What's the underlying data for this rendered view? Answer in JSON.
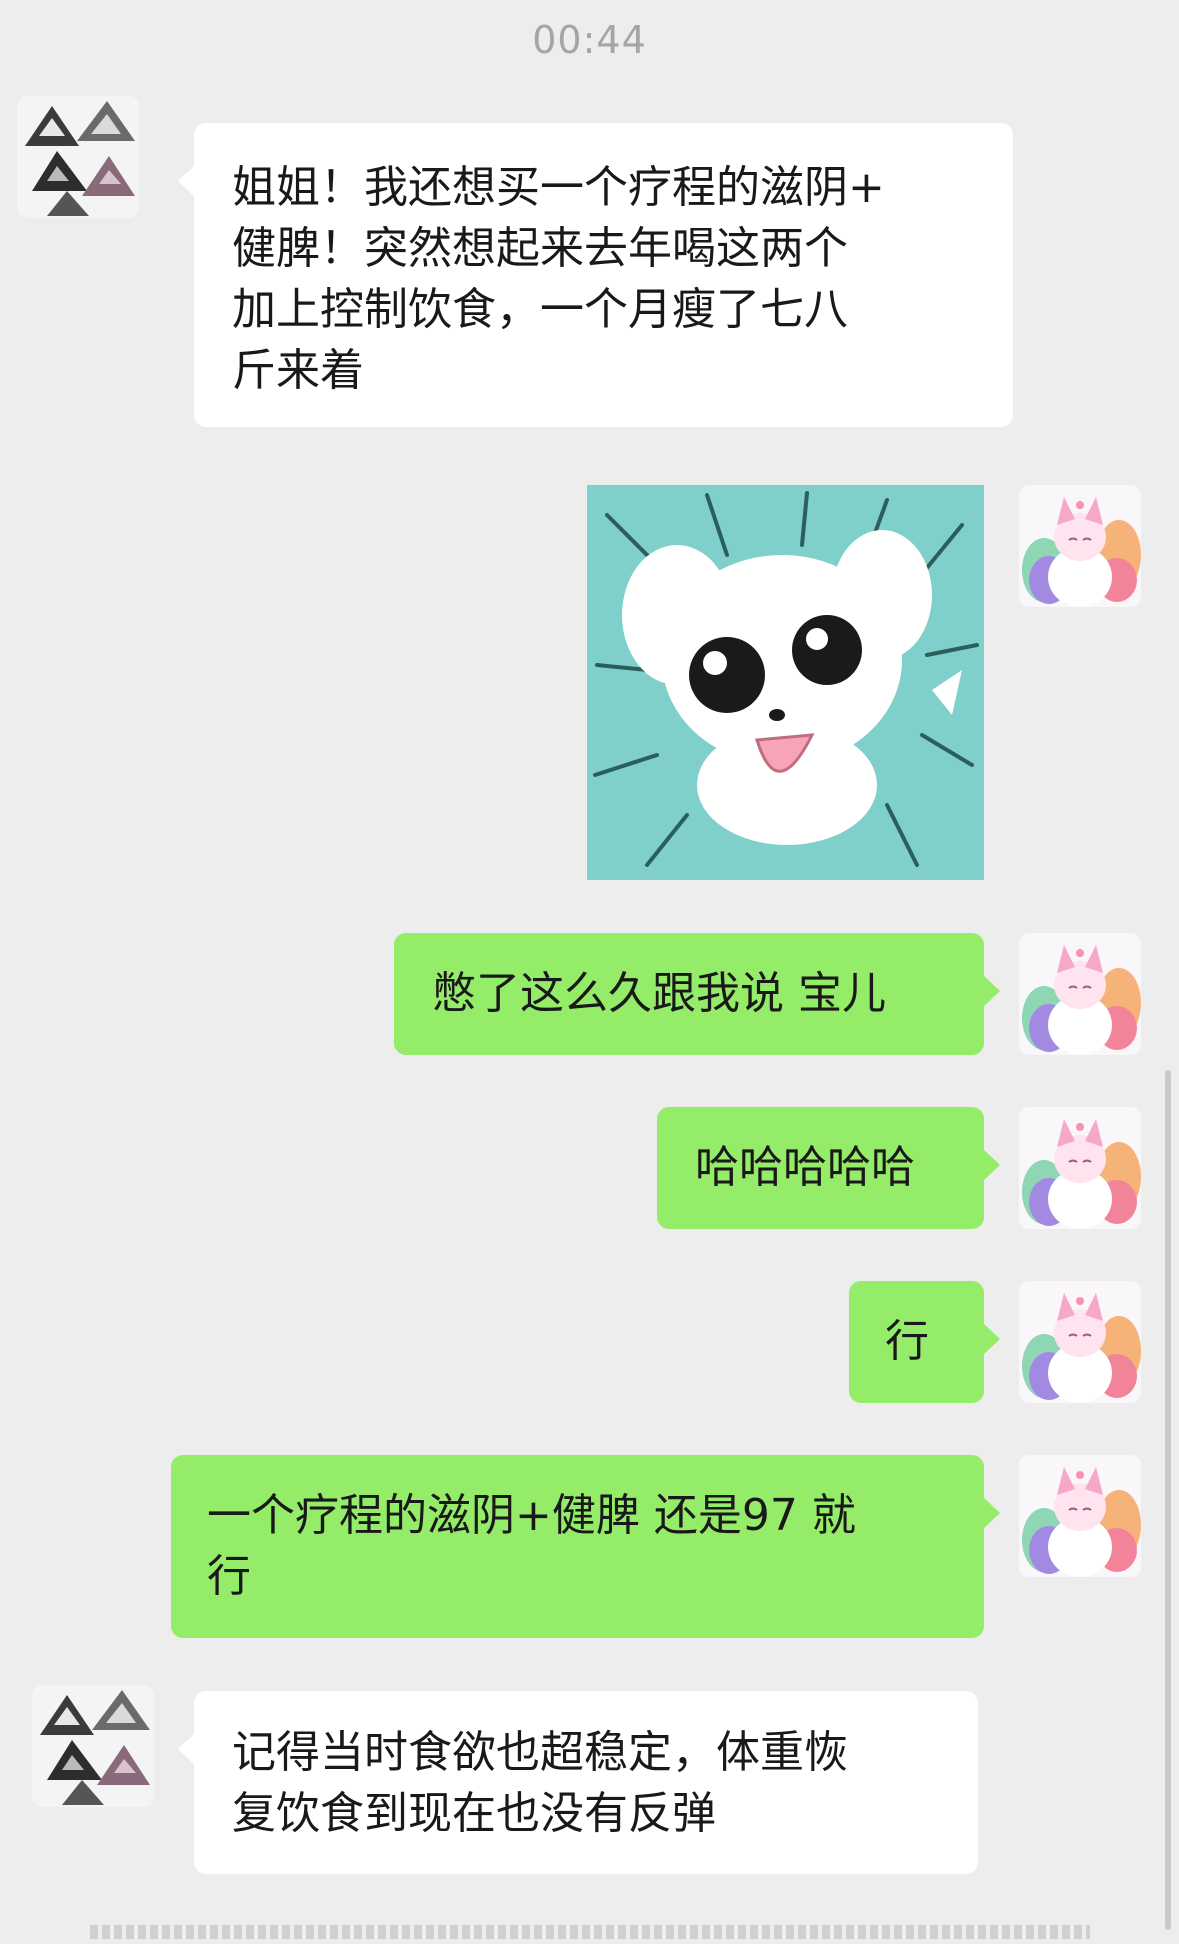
{
  "status": {
    "time": "00:44"
  },
  "contact": {
    "avatar_icon": "geometric-triangle-avatar"
  },
  "me": {
    "avatar_icon": "rainbow-fox-avatar"
  },
  "sticker": {
    "icon": "white-puppy-sticker"
  },
  "messages": [
    {
      "from": "contact",
      "lines": [
        "姐姐！我还想买一个疗程的滋阴+",
        "健脾！突然想起来去年喝这两个",
        "加上控制饮食，一个月瘦了七八",
        "斤来着"
      ]
    },
    {
      "from": "me",
      "lines": [
        "憋了这么久跟我说 宝儿"
      ]
    },
    {
      "from": "me",
      "lines": [
        "哈哈哈哈哈"
      ]
    },
    {
      "from": "me",
      "lines": [
        "行"
      ]
    },
    {
      "from": "me",
      "lines": [
        "一个疗程的滋阴+健脾 还是97 就",
        "行"
      ]
    },
    {
      "from": "contact",
      "lines": [
        "记得当时食欲也超稳定，体重恢",
        "复饮食到现在也没有反弹"
      ]
    }
  ],
  "colors": {
    "background": "#ededed",
    "incoming_bubble": "#ffffff",
    "outgoing_bubble": "#95ec69",
    "sticker_background": "#7fd0cb"
  }
}
